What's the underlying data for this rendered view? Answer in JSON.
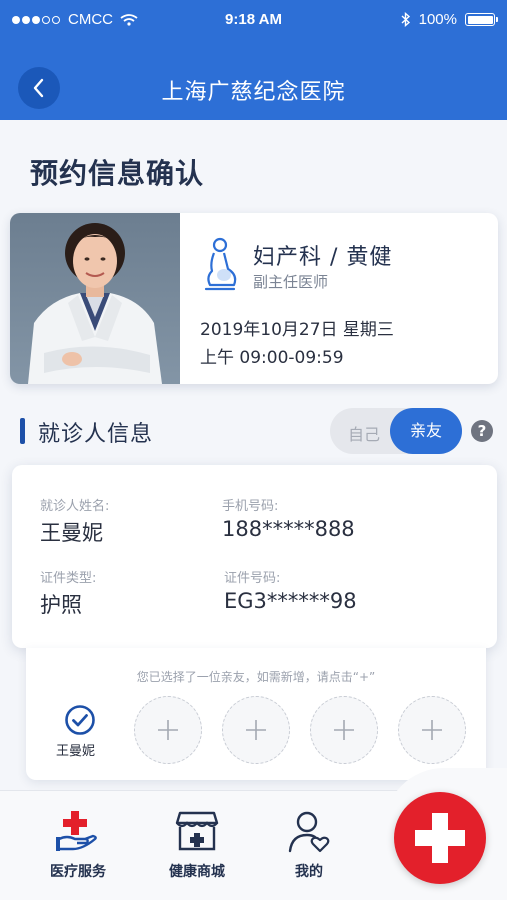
{
  "status_bar": {
    "carrier": "CMCC",
    "time": "9:18 AM",
    "battery": "100%"
  },
  "nav": {
    "title": "上海广慈纪念医院"
  },
  "page": {
    "title": "预约信息确认"
  },
  "doctor": {
    "department_name": "妇产科 / 黄健",
    "title": "副主任医师",
    "date": "2019年10月27日 星期三",
    "time": "上午 09:00-09:59"
  },
  "patient_section": {
    "title": "就诊人信息",
    "toggle_self": "自己",
    "toggle_friend": "亲友",
    "help": "?"
  },
  "patient_info": {
    "name_label": "就诊人姓名:",
    "name_value": "王曼妮",
    "phone_label": "手机号码:",
    "phone_value": "188*****888",
    "id_type_label": "证件类型:",
    "id_type_value": "护照",
    "id_number_label": "证件号码:",
    "id_number_value": "EG3******98"
  },
  "friends_picker": {
    "hint": "您已选择了一位亲友，如需新增，请点击“+”",
    "selected_name": "王曼妮",
    "add_slots": [
      "+",
      "+",
      "+",
      "+"
    ]
  },
  "tabbar": {
    "items": [
      {
        "label": "医疗服务",
        "icon": "medical-service-icon"
      },
      {
        "label": "健康商城",
        "icon": "health-store-icon"
      },
      {
        "label": "我的",
        "icon": "user-heart-icon"
      }
    ],
    "fab_icon": "red-cross-icon"
  },
  "colors": {
    "primary": "#2d6fd6",
    "accent_dark": "#1d50a8",
    "fab_red": "#e3202b"
  }
}
